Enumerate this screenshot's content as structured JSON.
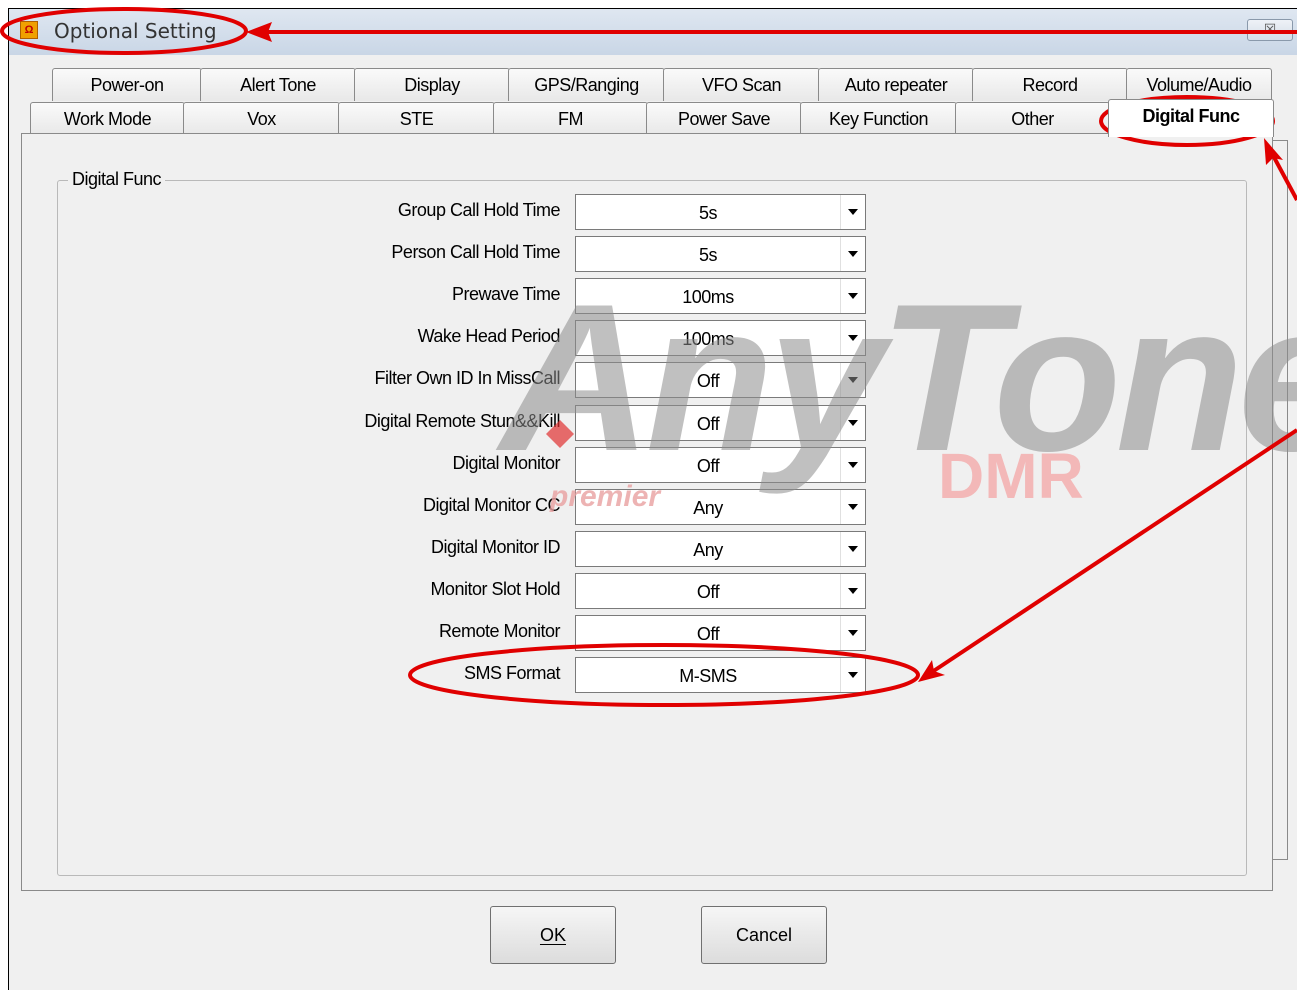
{
  "window": {
    "title": "Optional Setting",
    "close_glyph": "☒"
  },
  "tabs_row1": [
    "Power-on",
    "Alert Tone",
    "Display",
    "GPS/Ranging",
    "VFO Scan",
    "Auto repeater",
    "Record",
    "Volume/Audio"
  ],
  "tabs_row2": [
    "Work Mode",
    "Vox",
    "STE",
    "FM",
    "Power Save",
    "Key Function",
    "Other",
    "Digital Func"
  ],
  "active_tab": "Digital Func",
  "group": {
    "title": "Digital Func",
    "rows": [
      {
        "label": "Group Call Hold Time",
        "value": "5s"
      },
      {
        "label": "Person Call Hold Time",
        "value": "5s"
      },
      {
        "label": "Prewave Time",
        "value": "100ms"
      },
      {
        "label": "Wake Head Period",
        "value": "100ms"
      },
      {
        "label": "Filter Own ID In MissCall",
        "value": "Off"
      },
      {
        "label": "Digital Remote Stun&&Kill",
        "value": "Off"
      },
      {
        "label": "Digital Monitor",
        "value": "Off"
      },
      {
        "label": "Digital Monitor CC",
        "value": "Any"
      },
      {
        "label": "Digital Monitor ID",
        "value": "Any"
      },
      {
        "label": "Monitor Slot Hold",
        "value": "Off"
      },
      {
        "label": "Remote Monitor",
        "value": "Off"
      },
      {
        "label": "SMS Format",
        "value": "M-SMS"
      }
    ]
  },
  "buttons": {
    "ok": "OK",
    "cancel": "Cancel"
  },
  "watermark": {
    "brand": "AnyTone",
    "sub": "DMR",
    "dealer": "premier"
  },
  "colors": {
    "annotation": "#e00000",
    "titlebar": "#d4deeb"
  }
}
